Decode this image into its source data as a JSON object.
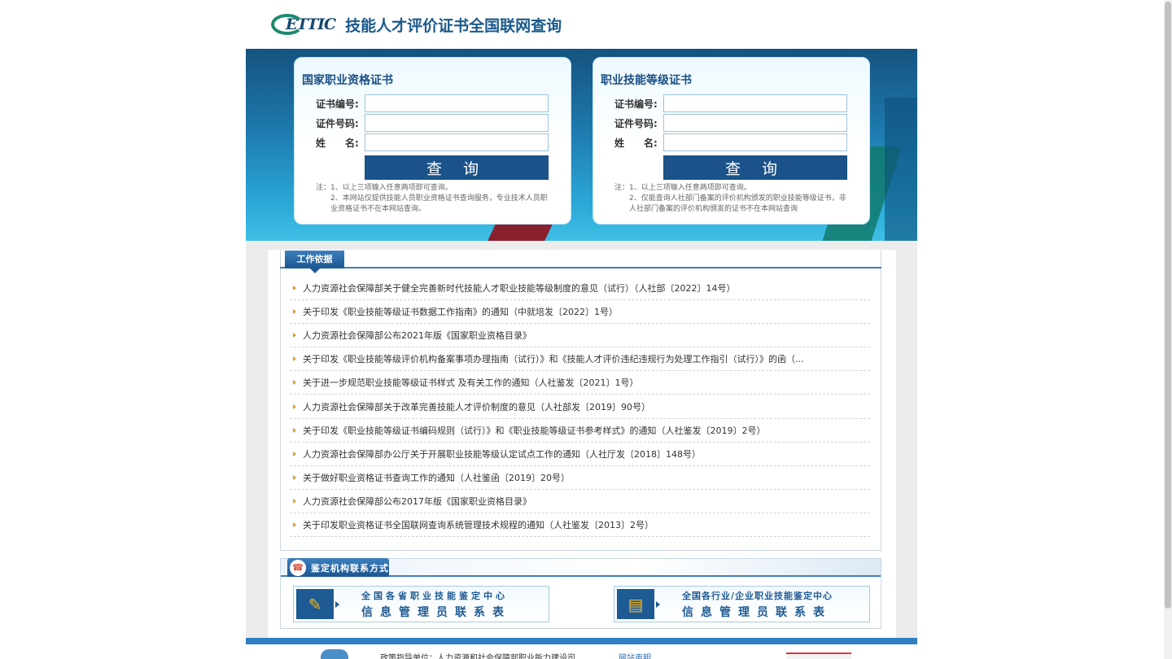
{
  "header": {
    "logo_text": "ETTIC",
    "site_title": "技能人才评价证书全国联网查询"
  },
  "query_left": {
    "title": "国家职业资格证书",
    "cert_no_label": "证书编号:",
    "id_no_label": "证件号码:",
    "name_label": "姓　　名:",
    "cert_no_value": "",
    "id_no_value": "",
    "name_value": "",
    "button_label": "查 询",
    "note_1": "注：1、以上三项输入任意两项即可查询。",
    "note_2": "2、本网站仅提供技能人员职业资格证书查询服务，专业技术人员职业资格证书不在本网站查询。"
  },
  "query_right": {
    "title": "职业技能等级证书",
    "cert_no_label": "证书编号:",
    "id_no_label": "证件号码:",
    "name_label": "姓　　名:",
    "cert_no_value": "",
    "id_no_value": "",
    "name_value": "",
    "button_label": "查 询",
    "note_1": "注：1、以上三项输入任意两项即可查询。",
    "note_2": "2、仅能查询人社部门备案的评价机构颁发的职业技能等级证书，非人社部门备案的评价机构颁发的证书不在本网站查询"
  },
  "work_basis": {
    "tab_label": "工作依据",
    "items": [
      "人力资源社会保障部关于健全完善新时代技能人才职业技能等级制度的意见（试行）（人社部〔2022〕14号）",
      "关于印发《职业技能等级证书数据工作指南》的通知（中就培发〔2022〕1号）",
      "人力资源社会保障部公布2021年版《国家职业资格目录》",
      "关于印发《职业技能等级评价机构备案事项办理指南（试行）》和《技能人才评价违纪违规行为处理工作指引（试行）》的函（...",
      "关于进一步规范职业技能等级证书样式 及有关工作的通知（人社鉴发〔2021〕1号）",
      "人力资源社会保障部关于改革完善技能人才评价制度的意见（人社部发〔2019〕90号）",
      "关于印发《职业技能等级证书编码规则（试行）》和《职业技能等级证书参考样式》的通知（人社鉴发〔2019〕2号）",
      "人力资源社会保障部办公厅关于开展职业技能等级认定试点工作的通知（人社厅发〔2018〕148号）",
      "关于做好职业资格证书查询工作的通知（人社鉴函〔2019〕20号）",
      "人力资源社会保障部公布2017年版《国家职业资格目录》",
      "关于印发职业资格证书全国联网查询系统管理技术规程的通知（人社鉴发〔2013〕2号）"
    ]
  },
  "contact": {
    "tab_label": "鉴定机构联系方式",
    "left_line1": "全国各省职业技能鉴定中心",
    "left_line2": "信息管理员联系表",
    "right_line1": "全国各行业/企业职业技能鉴定中心",
    "right_line2": "信息管理员联系表"
  },
  "footer": {
    "guidance": "政策指导单位：人力资源和社会保障部职业能力建设司",
    "link": "网站声明"
  }
}
